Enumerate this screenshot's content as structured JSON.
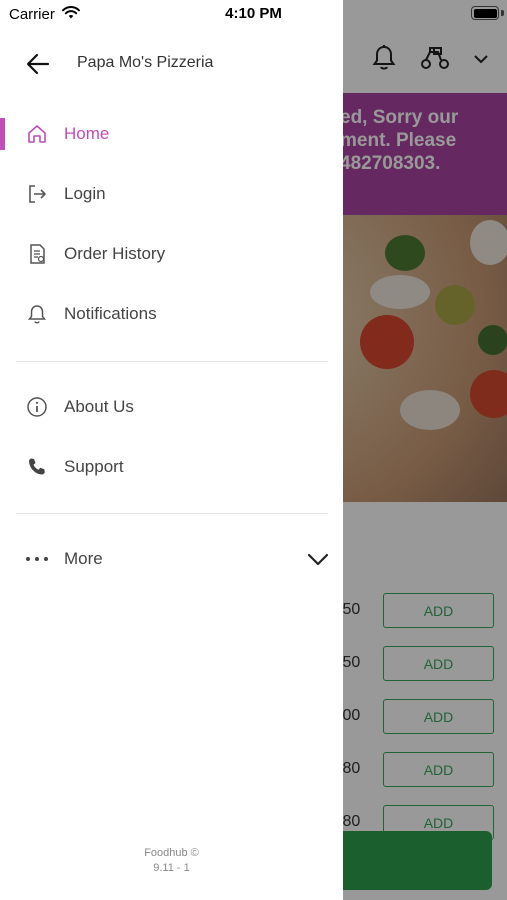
{
  "status_bar": {
    "carrier": "Carrier",
    "time": "4:10 PM"
  },
  "drawer": {
    "title": "Papa Mo's Pizzeria",
    "items": [
      {
        "label": "Home",
        "icon": "home-icon",
        "active": true
      },
      {
        "label": "Login",
        "icon": "login-icon",
        "active": false
      },
      {
        "label": "Order History",
        "icon": "receipt-icon",
        "active": false
      },
      {
        "label": "Notifications",
        "icon": "bell-icon",
        "active": false
      },
      {
        "label": "About Us",
        "icon": "info-icon",
        "active": false
      },
      {
        "label": "Support",
        "icon": "phone-icon",
        "active": false
      },
      {
        "label": "More",
        "icon": "more-icon",
        "active": false
      }
    ],
    "footer_line1": "Foodhub ©",
    "footer_line2": "9.11 - 1"
  },
  "background": {
    "banner_lines": [
      "ed, Sorry our",
      "ment. Please",
      "482708303."
    ],
    "rows": [
      {
        "price": ".50",
        "add_label": "ADD"
      },
      {
        "price": ".50",
        "add_label": "ADD"
      },
      {
        "price": ".00",
        "add_label": "ADD"
      },
      {
        "price": ".80",
        "add_label": "ADD"
      },
      {
        "price": ".80",
        "add_label": "ADD"
      }
    ]
  },
  "colors": {
    "accent": "#c14db9",
    "banner": "#a844a0",
    "add_green": "#39a55e"
  }
}
